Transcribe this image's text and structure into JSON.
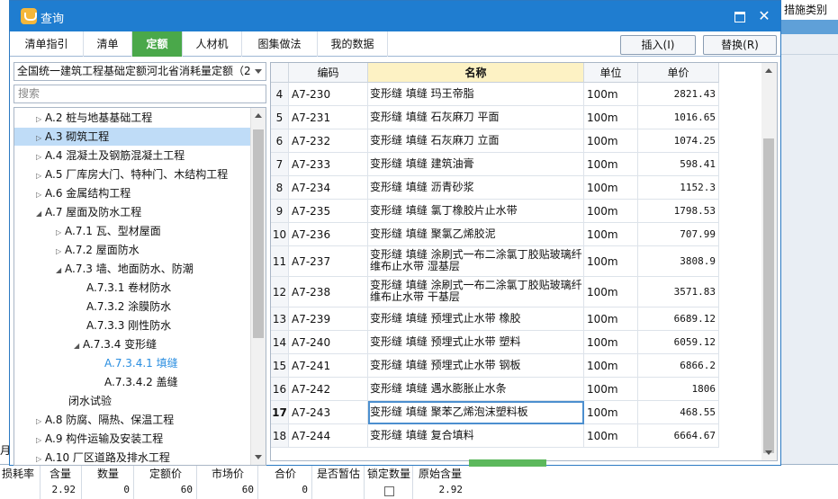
{
  "background": {
    "top_right_label": "措施类别",
    "left_label": "月",
    "grid_headers": [
      "损耗率",
      "含量",
      "数量",
      "定额价",
      "市场价",
      "合价",
      "是否暂估",
      "锁定数量",
      "原始含量"
    ],
    "grid_values": [
      "",
      "2.92",
      "0",
      "60",
      "60",
      "0",
      "",
      "",
      "2.92"
    ]
  },
  "dialog": {
    "title": "查询",
    "tabs": [
      "清单指引",
      "清单",
      "定额",
      "人材机",
      "图集做法",
      "我的数据"
    ],
    "active_tab": 2,
    "insert_label": "插入(I)",
    "replace_label": "替换(R)"
  },
  "left": {
    "library_select": "全国统一建筑工程基础定额河北省消耗量定额（2",
    "search_placeholder": "搜索",
    "tree": [
      {
        "label": "A.2 桩与地基基础工程",
        "level": 1,
        "arrow": "closed"
      },
      {
        "label": "A.3 砌筑工程",
        "level": 1,
        "arrow": "closed",
        "selected": true
      },
      {
        "label": "A.4 混凝土及钢筋混凝土工程",
        "level": 1,
        "arrow": "closed"
      },
      {
        "label": "A.5 厂库房大门、特种门、木结构工程",
        "level": 1,
        "arrow": "closed"
      },
      {
        "label": "A.6 金属结构工程",
        "level": 1,
        "arrow": "closed"
      },
      {
        "label": "A.7 屋面及防水工程",
        "level": 1,
        "arrow": "open"
      },
      {
        "label": "A.7.1 瓦、型材屋面",
        "level": 2,
        "arrow": "closed"
      },
      {
        "label": "A.7.2 屋面防水",
        "level": 2,
        "arrow": "closed"
      },
      {
        "label": "A.7.3 墙、地面防水、防潮",
        "level": 2,
        "arrow": "open"
      },
      {
        "label": "A.7.3.1 卷材防水",
        "level": 3,
        "arrow": "none"
      },
      {
        "label": "A.7.3.2 涂膜防水",
        "level": 3,
        "arrow": "none"
      },
      {
        "label": "A.7.3.3 刚性防水",
        "level": 3,
        "arrow": "none"
      },
      {
        "label": "A.7.3.4 变形缝",
        "level": 3,
        "arrow": "open"
      },
      {
        "label": "A.7.3.4.1 填缝",
        "level": 4,
        "arrow": "none",
        "highlight": true
      },
      {
        "label": "A.7.3.4.2 盖缝",
        "level": 4,
        "arrow": "none"
      },
      {
        "label": "闭水试验",
        "level": 2,
        "arrow": "none"
      },
      {
        "label": "A.8 防腐、隔热、保温工程",
        "level": 1,
        "arrow": "closed"
      },
      {
        "label": "A.9 构件运输及安装工程",
        "level": 1,
        "arrow": "closed"
      },
      {
        "label": "A.10 厂区道路及排水工程",
        "level": 1,
        "arrow": "closed"
      }
    ]
  },
  "grid": {
    "headers": [
      "",
      "编码",
      "名称",
      "单位",
      "单价"
    ],
    "rows": [
      {
        "idx": "4",
        "code": "A7-230",
        "name": "变形缝 填缝 玛王帝脂",
        "unit": "100m",
        "price": "2821.43"
      },
      {
        "idx": "5",
        "code": "A7-231",
        "name": "变形缝 填缝 石灰麻刀 平面",
        "unit": "100m",
        "price": "1016.65"
      },
      {
        "idx": "6",
        "code": "A7-232",
        "name": "变形缝 填缝 石灰麻刀 立面",
        "unit": "100m",
        "price": "1074.25"
      },
      {
        "idx": "7",
        "code": "A7-233",
        "name": "变形缝 填缝 建筑油膏",
        "unit": "100m",
        "price": "598.41"
      },
      {
        "idx": "8",
        "code": "A7-234",
        "name": "变形缝 填缝 沥青砂浆",
        "unit": "100m",
        "price": "1152.3"
      },
      {
        "idx": "9",
        "code": "A7-235",
        "name": "变形缝 填缝 氯丁橡胶片止水带",
        "unit": "100m",
        "price": "1798.53"
      },
      {
        "idx": "10",
        "code": "A7-236",
        "name": "变形缝 填缝 聚氯乙烯胶泥",
        "unit": "100m",
        "price": "707.99"
      },
      {
        "idx": "11",
        "code": "A7-237",
        "name": "变形缝 填缝 涂刷式一布二涂氯丁胶贴玻璃纤维布止水带 湿基层",
        "unit": "100m",
        "price": "3808.9"
      },
      {
        "idx": "12",
        "code": "A7-238",
        "name": "变形缝 填缝 涂刷式一布二涂氯丁胶贴玻璃纤维布止水带 干基层",
        "unit": "100m",
        "price": "3571.83"
      },
      {
        "idx": "13",
        "code": "A7-239",
        "name": "变形缝 填缝 预埋式止水带 橡胶",
        "unit": "100m",
        "price": "6689.12"
      },
      {
        "idx": "14",
        "code": "A7-240",
        "name": "变形缝 填缝 预埋式止水带 塑料",
        "unit": "100m",
        "price": "6059.12"
      },
      {
        "idx": "15",
        "code": "A7-241",
        "name": "变形缝 填缝 预埋式止水带 钢板",
        "unit": "100m",
        "price": "6866.2"
      },
      {
        "idx": "16",
        "code": "A7-242",
        "name": "变形缝 填缝 遇水膨胀止水条",
        "unit": "100m",
        "price": "1806"
      },
      {
        "idx": "17",
        "code": "A7-243",
        "name": "变形缝 填缝 聚苯乙烯泡沫塑料板",
        "unit": "100m",
        "price": "468.55",
        "current": true
      },
      {
        "idx": "18",
        "code": "A7-244",
        "name": "变形缝 填缝 复合填料",
        "unit": "100m",
        "price": "6664.67"
      }
    ]
  }
}
